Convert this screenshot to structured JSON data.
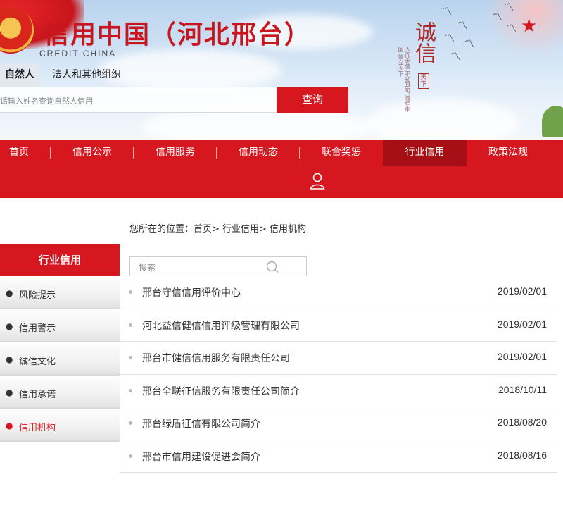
{
  "header": {
    "title": "信用中国（河北邢台）",
    "subtitle": "CREDIT CHINA",
    "calligraphy": "诚信",
    "seal": "天下",
    "poem": "人而无信 不知其可 诚信中国 信立天下"
  },
  "search": {
    "tabs": [
      {
        "label": "自然人"
      },
      {
        "label": "法人和其他组织"
      }
    ],
    "placeholder": "请输入姓名查询自然人信用",
    "button": "查询"
  },
  "nav": {
    "items": [
      {
        "label": "首页"
      },
      {
        "label": "信用公示"
      },
      {
        "label": "信用服务"
      },
      {
        "label": "信用动态"
      },
      {
        "label": "联合奖惩"
      },
      {
        "label": "行业信用"
      },
      {
        "label": "政策法规"
      }
    ],
    "active_index": 5,
    "user_icon": "user-icon"
  },
  "breadcrumb": {
    "text": "您所在的位置：首页> 行业信用> 信用机构"
  },
  "sidebar": {
    "title": "行业信用",
    "items": [
      {
        "label": "风险提示"
      },
      {
        "label": "信用警示"
      },
      {
        "label": "诚信文化"
      },
      {
        "label": "信用承诺"
      },
      {
        "label": "信用机构"
      }
    ],
    "current_index": 4
  },
  "content": {
    "filter_placeholder": "搜索",
    "rows": [
      {
        "title": "邢台守信信用评价中心",
        "date": "2019/02/01"
      },
      {
        "title": "河北益信健信信用评级管理有限公司",
        "date": "2019/02/01"
      },
      {
        "title": "邢台市健信信用服务有限责任公司",
        "date": "2019/02/01"
      },
      {
        "title": "邢台全联征信服务有限责任公司简介",
        "date": "2018/10/11"
      },
      {
        "title": "邢台绿盾征信有限公司简介",
        "date": "2018/08/20"
      },
      {
        "title": "邢台市信用建设促进会简介",
        "date": "2018/08/16"
      }
    ]
  },
  "colors": {
    "brand_red": "#d7171f",
    "active_red": "#a50f15"
  }
}
